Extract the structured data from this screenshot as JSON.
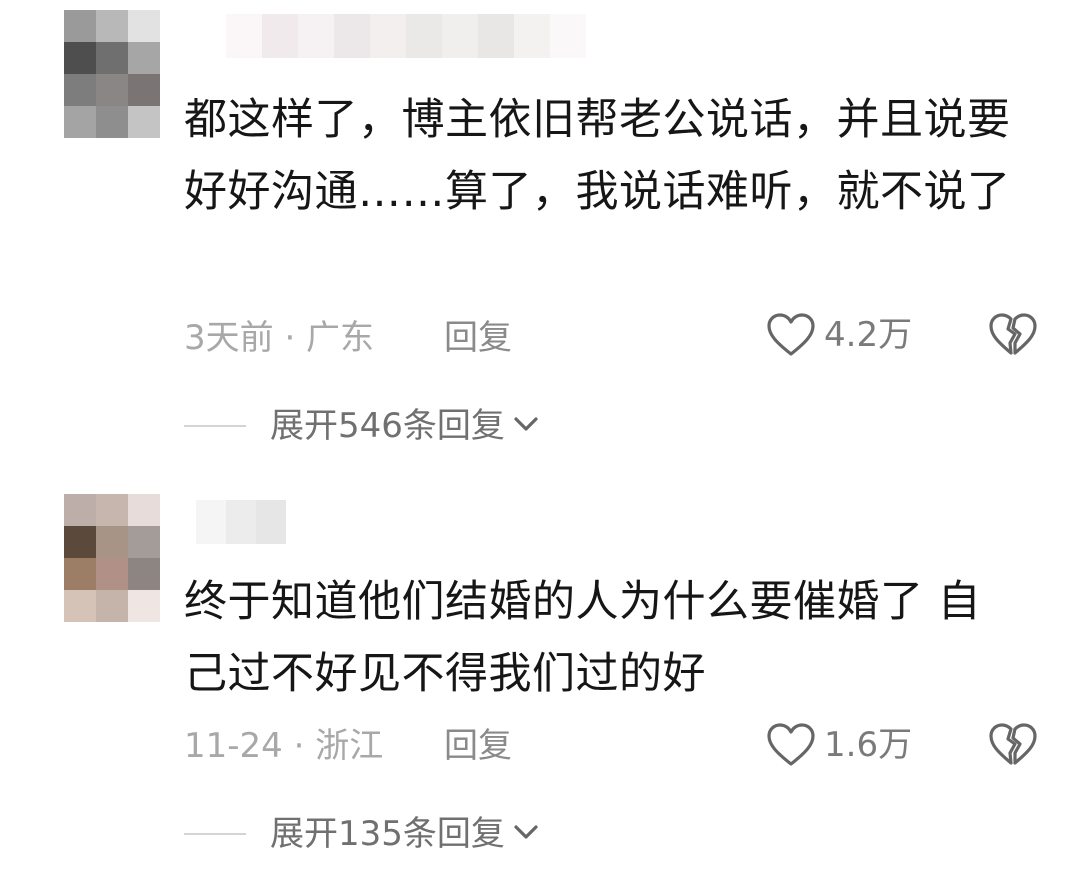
{
  "comments": [
    {
      "text": "都这样了，博主依旧帮老公说话，并且说要好好沟通……算了，我说话难听，就不说了",
      "time_location": "3天前 · 广东",
      "reply_label": "回复",
      "like_count": "4.2万",
      "expand_label": "展开546条回复"
    },
    {
      "text": "终于知道他们结婚的人为什么要催婚了 自己过不好见不得我们过的好",
      "time_location": "11-24 · 浙江",
      "reply_label": "回复",
      "like_count": "1.6万",
      "expand_label": "展开135条回复"
    }
  ],
  "colors": {
    "text": "#161616",
    "meta": "#a8a8a8",
    "icon": "#666666"
  },
  "icons": {
    "like": "heart-outline-icon",
    "dislike": "broken-heart-icon",
    "expand": "chevron-down-icon"
  }
}
